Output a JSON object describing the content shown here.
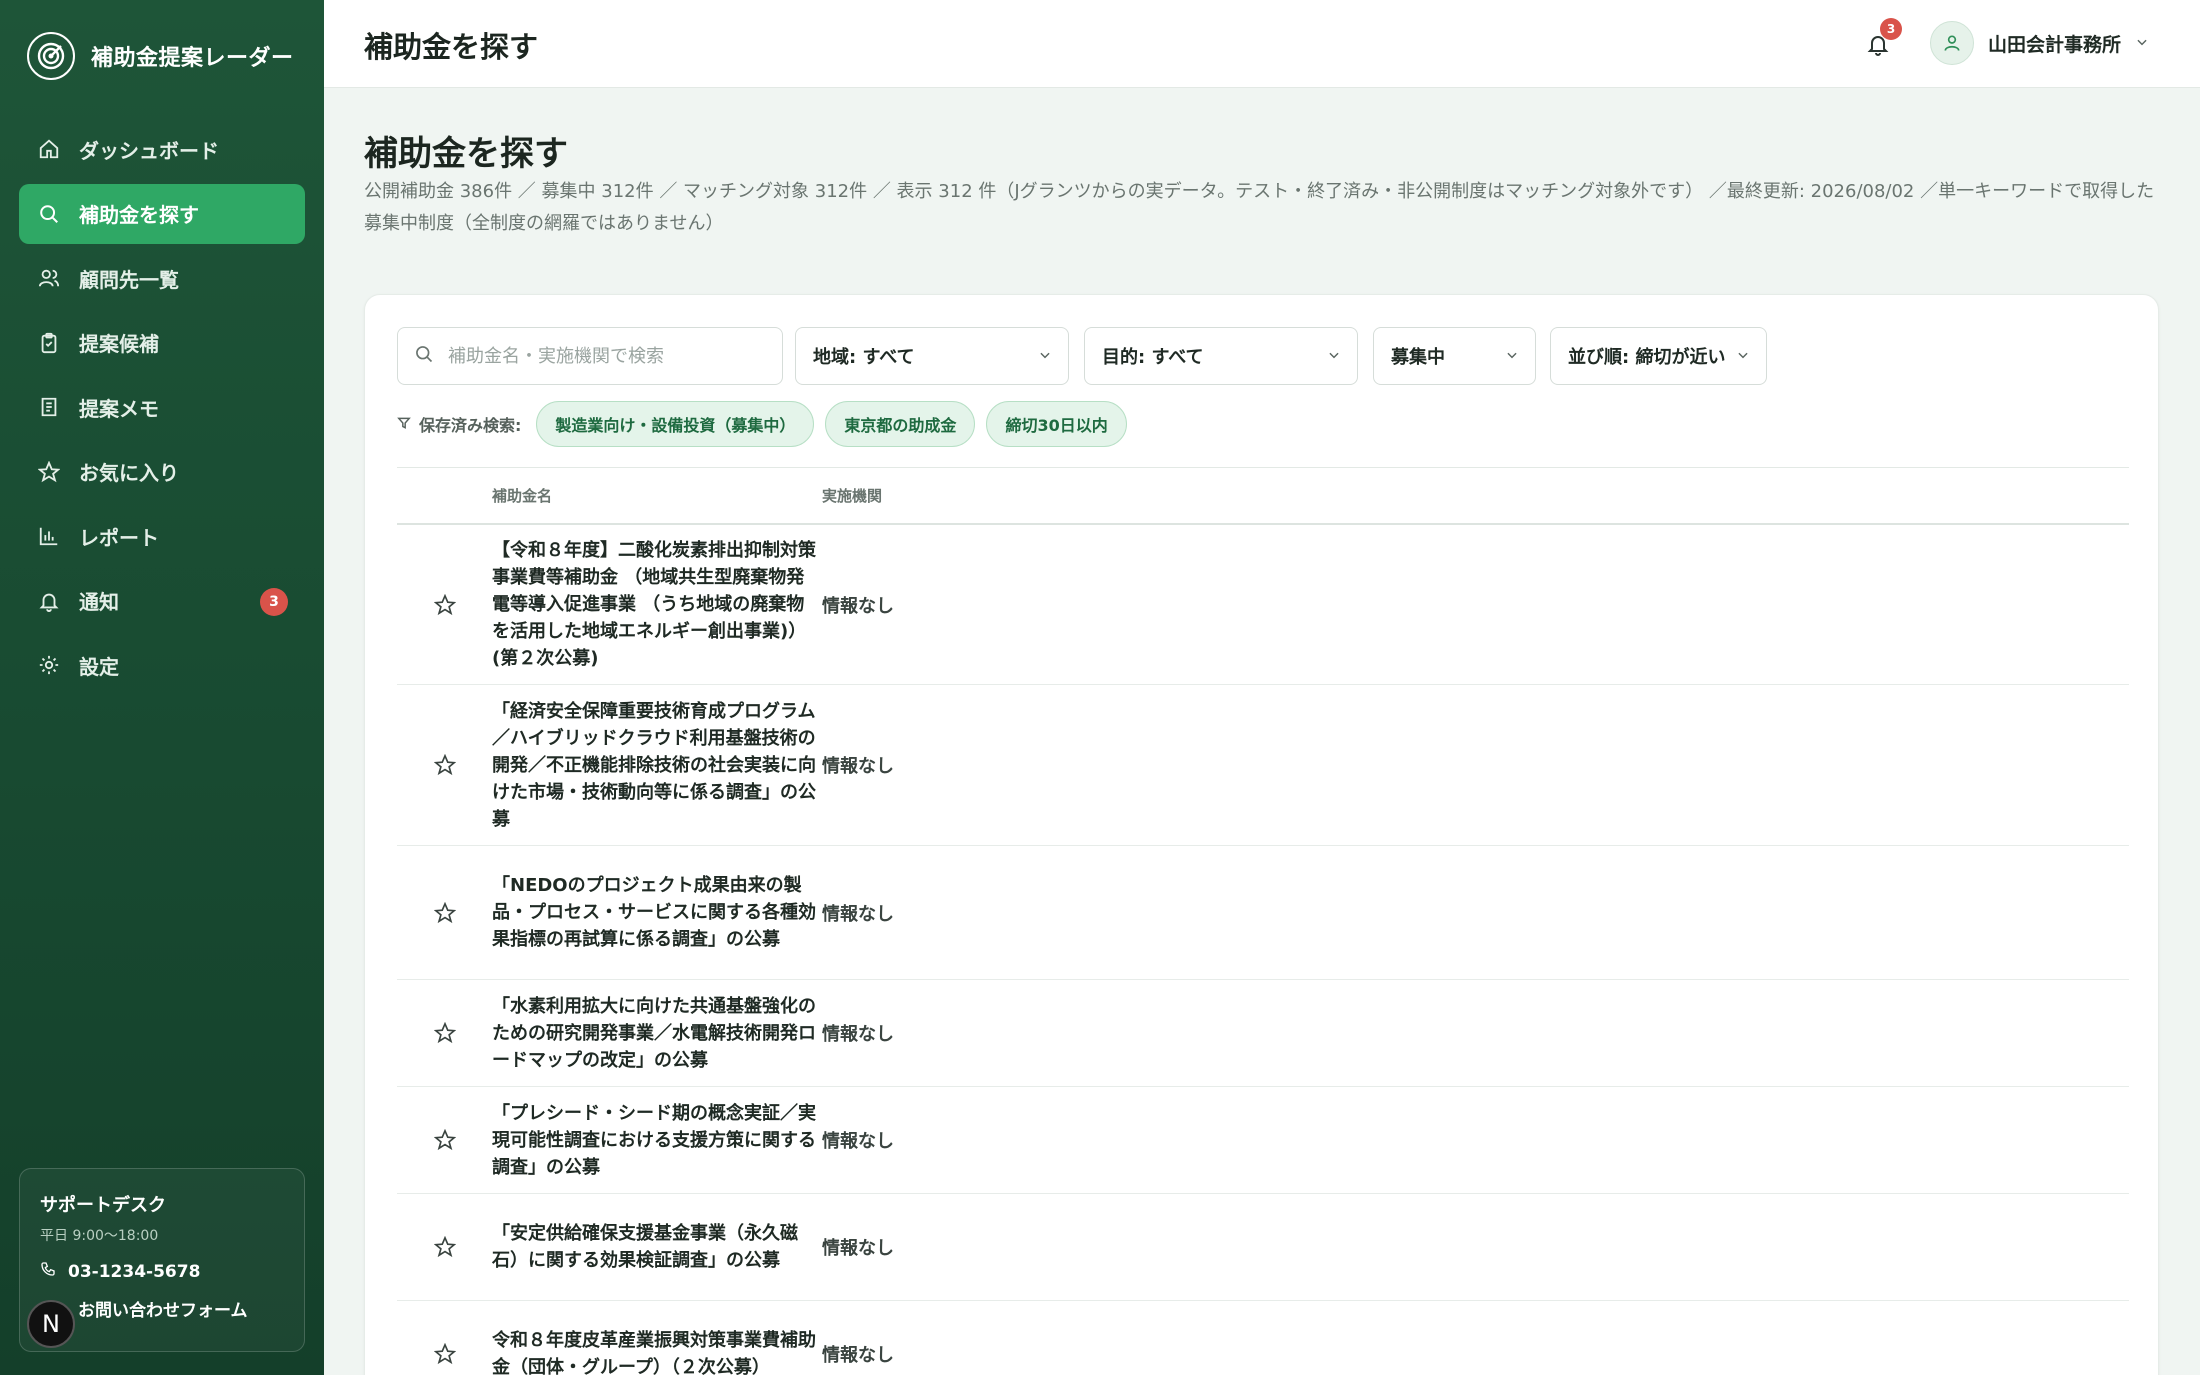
{
  "brand": {
    "title": "補助金提案レーダー"
  },
  "sidebar": {
    "items": [
      {
        "label": "ダッシュボード",
        "icon": "home-icon"
      },
      {
        "label": "補助金を探す",
        "icon": "search-icon",
        "active": true
      },
      {
        "label": "顧問先一覧",
        "icon": "users-icon"
      },
      {
        "label": "提案候補",
        "icon": "clipboard-check-icon"
      },
      {
        "label": "提案メモ",
        "icon": "memo-icon"
      },
      {
        "label": "お気に入り",
        "icon": "star-icon"
      },
      {
        "label": "レポート",
        "icon": "bar-chart-icon"
      },
      {
        "label": "通知",
        "icon": "bell-icon",
        "badge": "3"
      },
      {
        "label": "設定",
        "icon": "gear-icon"
      }
    ],
    "support": {
      "title": "サポートデスク",
      "hours": "平日 9:00〜18:00",
      "phone": "03-1234-5678",
      "form_label": "お問い合わせフォーム"
    }
  },
  "header": {
    "title": "補助金を探す",
    "notification_count": "3",
    "account_name": "山田会計事務所"
  },
  "page": {
    "title": "補助金を探す",
    "description": "公開補助金 386件 ／ 募集中 312件 ／ マッチング対象 312件 ／ 表示 312 件（Jグランツからの実データ。テスト・終了済み・非公開制度はマッチング対象外です） ／最終更新: 2026/08/02 ／単一キーワードで取得した募集中制度（全制度の網羅ではありません）"
  },
  "filters": {
    "search_placeholder": "補助金名・実施機関で検索",
    "region": "地域: すべて",
    "purpose": "目的: すべて",
    "status": "募集中",
    "sort": "並び順: 締切が近い"
  },
  "saved_searches": {
    "label": "保存済み検索:",
    "chips": [
      "製造業向け・設備投資（募集中）",
      "東京都の助成金",
      "締切30日以内"
    ]
  },
  "table": {
    "columns": [
      "補助金名",
      "実施機関"
    ],
    "rows": [
      {
        "name": "【令和８年度】二酸化炭素排出抑制対策事業費等補助金 （地域共生型廃棄物発電等導入促進事業 （うち地域の廃棄物を活用した地域エネルギー創出事業)）(第２次公募)",
        "org": "情報なし"
      },
      {
        "name": "「経済安全保障重要技術育成プログラム／ハイブリッドクラウド利用基盤技術の開発／不正機能排除技術の社会実装に向けた市場・技術動向等に係る調査」の公募",
        "org": "情報なし"
      },
      {
        "name": "「NEDOのプロジェクト成果由来の製品・プロセス・サービスに関する各種効果指標の再試算に係る調査」の公募",
        "org": "情報なし"
      },
      {
        "name": "「水素利用拡大に向けた共通基盤強化のための研究開発事業／水電解技術開発ロードマップの改定」の公募",
        "org": "情報なし"
      },
      {
        "name": "「プレシード・シード期の概念実証／実現可能性調査における支援方策に関する調査」の公募",
        "org": "情報なし"
      },
      {
        "name": "「安定供給確保支援基金事業（永久磁石）に関する効果検証調査」の公募",
        "org": "情報なし"
      },
      {
        "name": "令和８年度皮革産業振興対策事業費補助金（団体・グループ）（２次公募）",
        "org": "情報なし"
      }
    ]
  },
  "colors": {
    "sidebar": "#1e5538",
    "accent": "#2fa865",
    "badge": "#d9534a",
    "chip_bg": "#e4f4ea"
  }
}
